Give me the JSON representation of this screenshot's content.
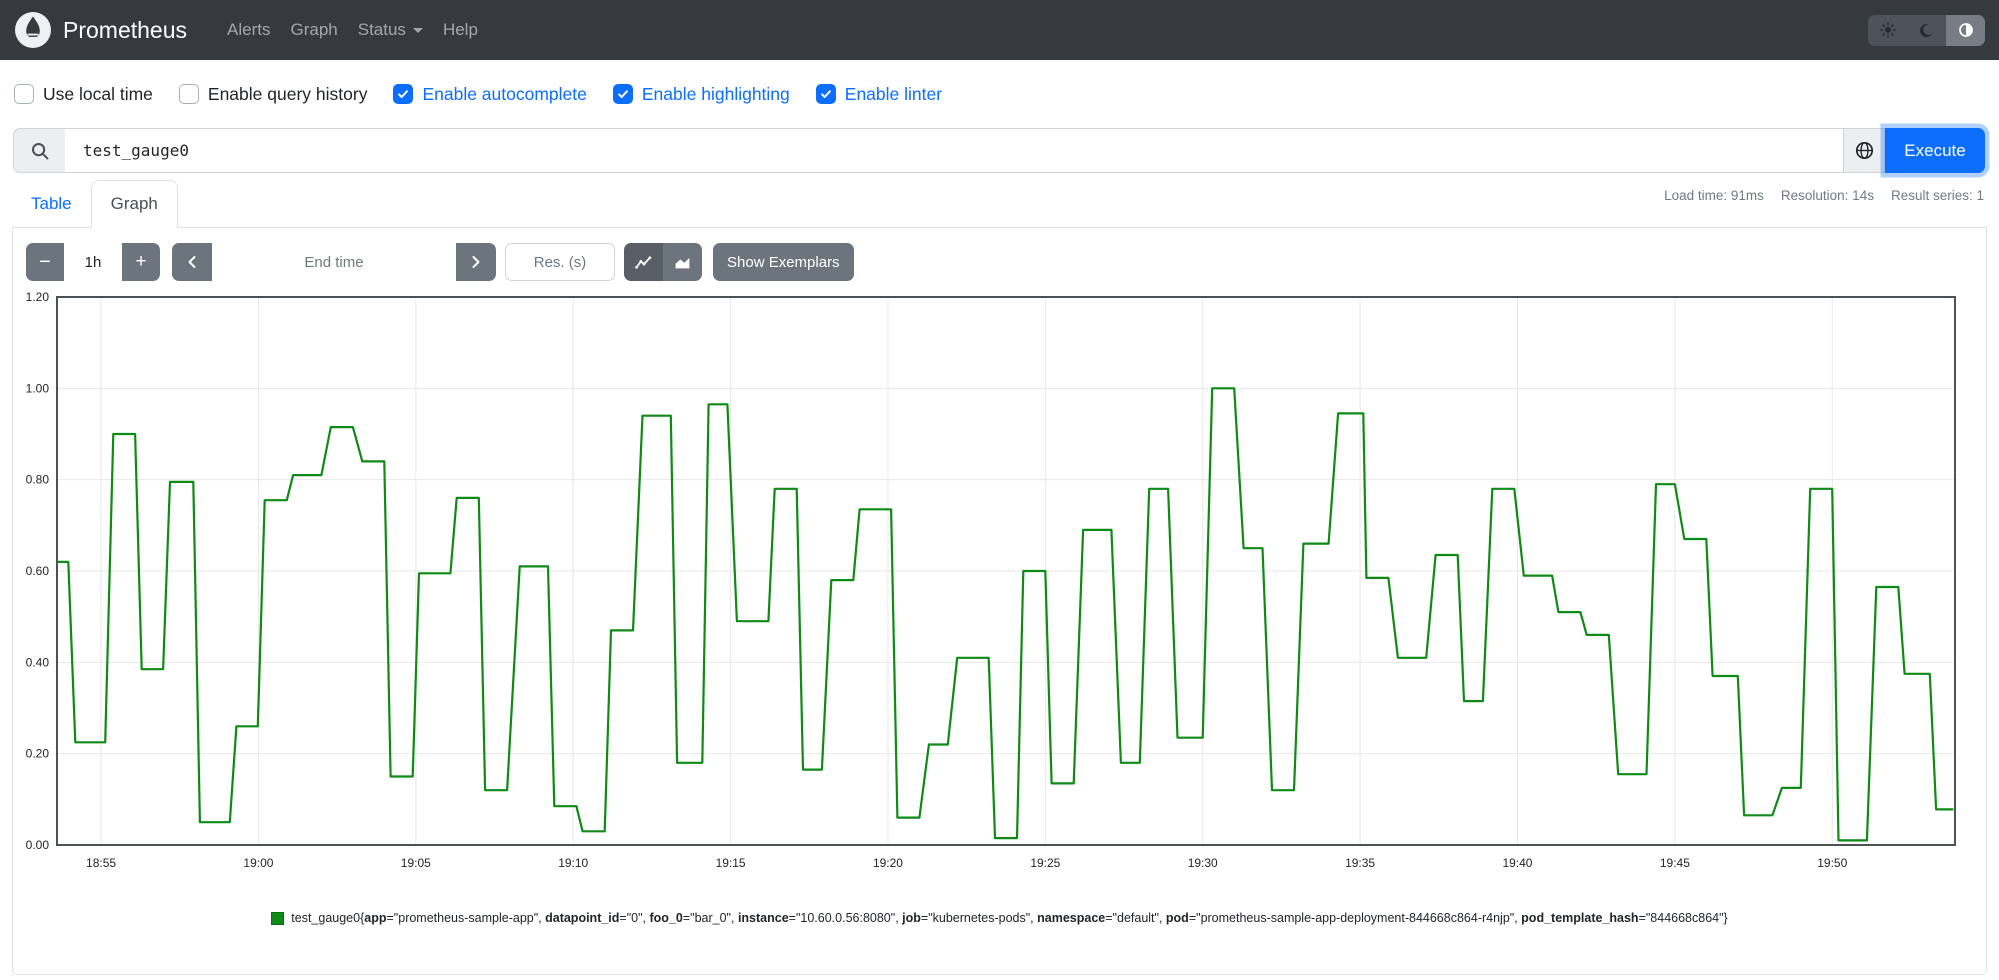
{
  "navbar": {
    "brand": "Prometheus",
    "items": [
      {
        "label": "Alerts"
      },
      {
        "label": "Graph"
      },
      {
        "label": "Status",
        "has_caret": true
      },
      {
        "label": "Help"
      }
    ],
    "theme_toggle": [
      {
        "name": "light",
        "icon": "sun",
        "active": false
      },
      {
        "name": "dark",
        "icon": "moon",
        "active": false
      },
      {
        "name": "auto",
        "icon": "auto",
        "active": true
      }
    ]
  },
  "options": {
    "accent": "#0d6efd",
    "items": [
      {
        "label": "Use local time",
        "checked": false
      },
      {
        "label": "Enable query history",
        "checked": false
      },
      {
        "label": "Enable autocomplete",
        "checked": true
      },
      {
        "label": "Enable highlighting",
        "checked": true
      },
      {
        "label": "Enable linter",
        "checked": true
      }
    ]
  },
  "query": {
    "value": "test_gauge0",
    "execute_label": "Execute",
    "search_icon": "search-icon",
    "explorer_icon": "globe-icon"
  },
  "tabs": {
    "items": [
      {
        "label": "Table",
        "active": false
      },
      {
        "label": "Graph",
        "active": true
      }
    ]
  },
  "stats": {
    "load_time": "Load time: 91ms",
    "resolution": "Resolution: 14s",
    "result_series": "Result series: 1"
  },
  "controls": {
    "minus": "−",
    "plus": "+",
    "range_value": "1h",
    "prev_icon": "chevron-left-icon",
    "next_icon": "chevron-right-icon",
    "end_time_placeholder": "End time",
    "res_placeholder": "Res. (s)",
    "line_toggle_icon": "line-chart-icon",
    "stacked_toggle_icon": "stacked-chart-icon",
    "show_exemplars": "Show Exemplars"
  },
  "colors": {
    "accent": "#0d6efd",
    "navbar_bg": "#343a40",
    "button_gray": "#6c757d",
    "series_green": "#0e8a16"
  },
  "chart_data": {
    "type": "line",
    "step": true,
    "grid": true,
    "x_axis": {
      "unit": "minutes after 18:50",
      "window": [
        3.6,
        63.9
      ],
      "ticks": [
        {
          "t": 5,
          "label": "18:55"
        },
        {
          "t": 10,
          "label": "19:00"
        },
        {
          "t": 15,
          "label": "19:05"
        },
        {
          "t": 20,
          "label": "19:10"
        },
        {
          "t": 25,
          "label": "19:15"
        },
        {
          "t": 30,
          "label": "19:20"
        },
        {
          "t": 35,
          "label": "19:25"
        },
        {
          "t": 40,
          "label": "19:30"
        },
        {
          "t": 45,
          "label": "19:35"
        },
        {
          "t": 50,
          "label": "19:40"
        },
        {
          "t": 55,
          "label": "19:45"
        },
        {
          "t": 60,
          "label": "19:50"
        }
      ]
    },
    "y_axis": {
      "min": 0,
      "max": 1.2,
      "ticks": [
        {
          "v": 0,
          "label": "0.00"
        },
        {
          "v": 0.2,
          "label": "0.20"
        },
        {
          "v": 0.4,
          "label": "0.40"
        },
        {
          "v": 0.6,
          "label": "0.60"
        },
        {
          "v": 0.8,
          "label": "0.80"
        },
        {
          "v": 1,
          "label": "1.00"
        },
        {
          "v": 1.2,
          "label": "1.20"
        }
      ]
    },
    "series": [
      {
        "name": "test_gauge0",
        "color": "#0e8a16",
        "swatch_border": "#0a6e11",
        "legend_labels": [
          [
            "app",
            "prometheus-sample-app"
          ],
          [
            "datapoint_id",
            "0"
          ],
          [
            "foo_0",
            "bar_0"
          ],
          [
            "instance",
            "10.60.0.56:8080"
          ],
          [
            "job",
            "kubernetes-pods"
          ],
          [
            "namespace",
            "default"
          ],
          [
            "pod",
            "prometheus-sample-app-deployment-844668c864-r4njp"
          ],
          [
            "pod_template_hash",
            "844668c864"
          ]
        ],
        "levels": [
          [
            3.75,
            3.96,
            0.62
          ],
          [
            4.18,
            5.13,
            0.225
          ],
          [
            5.39,
            6.08,
            0.9
          ],
          [
            6.29,
            6.97,
            0.385
          ],
          [
            7.19,
            7.93,
            0.795
          ],
          [
            8.14,
            9.09,
            0.05
          ],
          [
            9.3,
            9.98,
            0.26
          ],
          [
            10.2,
            10.9,
            0.755
          ],
          [
            11.1,
            12.0,
            0.81
          ],
          [
            12.3,
            13.0,
            0.915
          ],
          [
            13.3,
            14.0,
            0.84
          ],
          [
            14.2,
            14.9,
            0.15
          ],
          [
            15.1,
            16.1,
            0.595
          ],
          [
            16.3,
            17.0,
            0.76
          ],
          [
            17.2,
            17.9,
            0.12
          ],
          [
            18.3,
            19.2,
            0.61
          ],
          [
            19.4,
            20.1,
            0.085
          ],
          [
            20.3,
            21.0,
            0.03
          ],
          [
            21.2,
            21.9,
            0.47
          ],
          [
            22.2,
            23.1,
            0.94
          ],
          [
            23.3,
            24.1,
            0.18
          ],
          [
            24.3,
            24.9,
            0.965
          ],
          [
            25.2,
            26.2,
            0.49
          ],
          [
            26.4,
            27.1,
            0.78
          ],
          [
            27.3,
            27.9,
            0.165
          ],
          [
            28.2,
            28.9,
            0.58
          ],
          [
            29.1,
            30.1,
            0.735
          ],
          [
            30.3,
            31.0,
            0.06
          ],
          [
            31.3,
            31.9,
            0.22
          ],
          [
            32.2,
            33.2,
            0.41
          ],
          [
            33.4,
            34.1,
            0.015
          ],
          [
            34.3,
            35.0,
            0.6
          ],
          [
            35.2,
            35.9,
            0.135
          ],
          [
            36.2,
            37.1,
            0.69
          ],
          [
            37.4,
            38.0,
            0.18
          ],
          [
            38.3,
            38.9,
            0.78
          ],
          [
            39.2,
            40.0,
            0.235
          ],
          [
            40.3,
            41.0,
            1.0
          ],
          [
            41.3,
            41.9,
            0.65
          ],
          [
            42.2,
            42.9,
            0.12
          ],
          [
            43.2,
            44.0,
            0.66
          ],
          [
            44.3,
            45.1,
            0.945
          ],
          [
            45.2,
            45.9,
            0.585
          ],
          [
            46.2,
            47.1,
            0.41
          ],
          [
            47.4,
            48.1,
            0.635
          ],
          [
            48.3,
            48.9,
            0.315
          ],
          [
            49.2,
            49.9,
            0.78
          ],
          [
            50.2,
            51.1,
            0.59
          ],
          [
            51.3,
            52.0,
            0.51
          ],
          [
            52.2,
            52.9,
            0.46
          ],
          [
            53.2,
            54.1,
            0.155
          ],
          [
            54.4,
            55.0,
            0.79
          ],
          [
            55.3,
            56.0,
            0.67
          ],
          [
            56.2,
            57.0,
            0.37
          ],
          [
            57.2,
            58.1,
            0.065
          ],
          [
            58.4,
            59.0,
            0.125
          ],
          [
            59.3,
            60.0,
            0.78
          ],
          [
            60.2,
            61.1,
            0.01
          ],
          [
            61.4,
            62.1,
            0.565
          ],
          [
            62.3,
            63.1,
            0.375
          ],
          [
            63.3,
            63.85,
            0.078
          ]
        ]
      }
    ]
  }
}
